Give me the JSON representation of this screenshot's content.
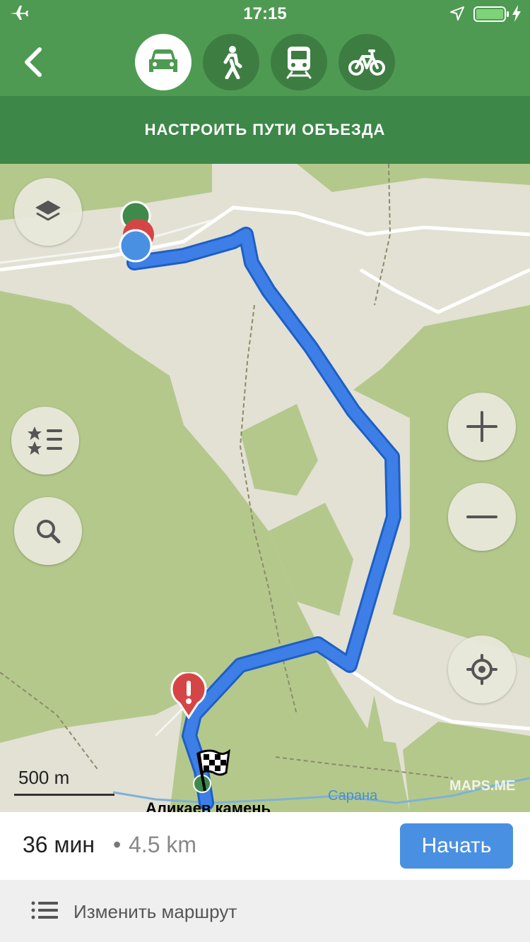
{
  "status_bar": {
    "time": "17:15",
    "battery_level": 0.9,
    "icons": [
      "airplane-icon",
      "location-arrow-icon",
      "battery-icon",
      "charging-bolt-icon"
    ]
  },
  "nav": {
    "back_icon": "chevron-left-icon",
    "modes": [
      {
        "name": "car",
        "icon": "car-icon",
        "active": true
      },
      {
        "name": "walk",
        "icon": "pedestrian-icon",
        "active": false
      },
      {
        "name": "transit",
        "icon": "train-icon",
        "active": false
      },
      {
        "name": "bike",
        "icon": "bicycle-icon",
        "active": false
      }
    ]
  },
  "avoid_bar": {
    "label": "НАСТРОИТЬ ПУТИ ОБЪЕЗДА"
  },
  "map": {
    "scale_label": "500 m",
    "watermark": "MAPS.ME",
    "river_label": "Сарана",
    "destination_label": "Аликаев камень",
    "route_color": "#3d7fe6"
  },
  "summary": {
    "time": "36 мин",
    "separator": "•",
    "distance": "4.5 km",
    "start_label": "Начать"
  },
  "edit_route": {
    "label": "Изменить маршрут"
  },
  "colors": {
    "header_green": "#4e9a52",
    "avoid_green": "#3d8748",
    "start_blue": "#4a90e2"
  }
}
